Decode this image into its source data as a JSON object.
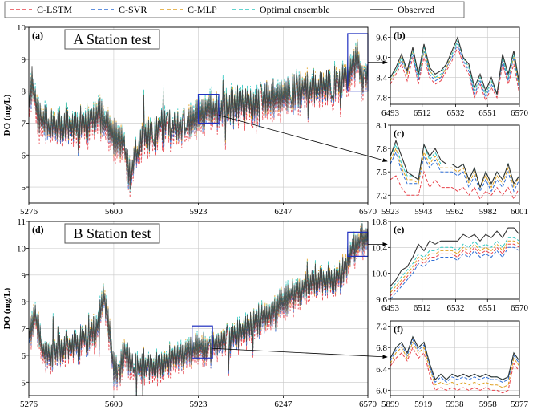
{
  "chart_data": {
    "type": "line",
    "legend": {
      "placement": "top",
      "entries": [
        {
          "label": "C-LSTM",
          "color": "#e8434b",
          "dash": "dashed"
        },
        {
          "label": "C-SVR",
          "color": "#2f6fd6",
          "dash": "dashed"
        },
        {
          "label": "C-MLP",
          "color": "#e0a020",
          "dash": "dashed"
        },
        {
          "label": "Optimal ensemble",
          "color": "#2ec7c0",
          "dash": "dashed"
        },
        {
          "label": "Observed",
          "color": "#444444",
          "dash": "solid"
        }
      ]
    },
    "ylabel": "DO (mg/L)",
    "grid": true,
    "panels": [
      {
        "id": "a",
        "letter": "(a)",
        "title": "A Station test",
        "xlim": [
          5276,
          6570
        ],
        "ylim": [
          4.5,
          10
        ],
        "xticks": [
          5276,
          5600,
          5923,
          6247,
          6570
        ],
        "yticks": [
          5,
          6,
          7,
          8,
          9,
          10
        ],
        "anchors": [
          [
            5276,
            7.8
          ],
          [
            5290,
            8.3
          ],
          [
            5310,
            7.3
          ],
          [
            5350,
            6.9
          ],
          [
            5420,
            6.9
          ],
          [
            5500,
            7.0
          ],
          [
            5540,
            7.3
          ],
          [
            5570,
            7.0
          ],
          [
            5600,
            6.6
          ],
          [
            5640,
            6.3
          ],
          [
            5660,
            5.3
          ],
          [
            5690,
            6.2
          ],
          [
            5720,
            6.6
          ],
          [
            5760,
            6.7
          ],
          [
            5800,
            7.0
          ],
          [
            5850,
            6.8
          ],
          [
            5900,
            7.1
          ],
          [
            5923,
            7.3
          ],
          [
            5960,
            7.5
          ],
          [
            6000,
            7.4
          ],
          [
            6050,
            7.6
          ],
          [
            6100,
            7.7
          ],
          [
            6150,
            7.6
          ],
          [
            6200,
            7.8
          ],
          [
            6247,
            7.9
          ],
          [
            6300,
            8.0
          ],
          [
            6350,
            8.1
          ],
          [
            6400,
            8.1
          ],
          [
            6450,
            8.3
          ],
          [
            6500,
            8.6
          ],
          [
            6530,
            9.1
          ],
          [
            6550,
            8.3
          ],
          [
            6570,
            8.6
          ]
        ],
        "zoom_box": [
          [
            5923,
            7.0
          ],
          [
            6001,
            7.9
          ]
        ]
      },
      {
        "id": "b",
        "letter": "(b)",
        "xlim": [
          6493,
          6570
        ],
        "ylim": [
          7.6,
          9.9
        ],
        "xticks": [
          6493,
          6512,
          6532,
          6551,
          6570
        ],
        "yticks": [
          7.8,
          8.4,
          9.0,
          9.6
        ],
        "observed": [
          8.4,
          8.7,
          9.1,
          8.6,
          9.3,
          8.5,
          9.4,
          8.7,
          8.5,
          8.6,
          8.8,
          9.2,
          9.6,
          9.0,
          8.8,
          8.1,
          8.5,
          8.0,
          8.4,
          7.9,
          9.1,
          8.5,
          9.2,
          8.2
        ],
        "series": [
          {
            "name": "C-LSTM",
            "values": [
              8.2,
              8.5,
              8.8,
              8.3,
              9.0,
              8.2,
              9.0,
              8.4,
              8.2,
              8.3,
              8.6,
              8.9,
              9.3,
              8.8,
              8.5,
              7.8,
              8.2,
              7.7,
              8.1,
              7.8,
              8.8,
              8.2,
              8.8,
              7.9
            ]
          },
          {
            "name": "C-SVR",
            "values": [
              8.3,
              8.6,
              8.9,
              8.5,
              9.1,
              8.3,
              9.2,
              8.5,
              8.3,
              8.4,
              8.7,
              9.0,
              9.4,
              8.9,
              8.6,
              7.9,
              8.3,
              7.8,
              8.2,
              7.9,
              8.9,
              8.3,
              9.0,
              8.0
            ]
          },
          {
            "name": "C-MLP",
            "values": [
              8.3,
              8.6,
              9.0,
              8.5,
              9.2,
              8.4,
              9.2,
              8.6,
              8.4,
              8.4,
              8.7,
              9.1,
              9.5,
              9.0,
              8.7,
              8.0,
              8.4,
              7.9,
              8.3,
              7.9,
              9.0,
              8.4,
              9.0,
              8.1
            ]
          },
          {
            "name": "Optimal ensemble",
            "values": [
              8.4,
              8.6,
              9.0,
              8.6,
              9.2,
              8.4,
              9.3,
              8.6,
              8.4,
              8.5,
              8.8,
              9.1,
              9.5,
              9.0,
              8.7,
              8.0,
              8.4,
              7.9,
              8.3,
              7.9,
              9.0,
              8.4,
              9.1,
              8.1
            ]
          }
        ]
      },
      {
        "id": "c",
        "letter": "(c)",
        "xlim": [
          5923,
          6001
        ],
        "ylim": [
          7.1,
          8.1
        ],
        "xticks": [
          5923,
          5943,
          5962,
          5982,
          6001
        ],
        "yticks": [
          7.2,
          7.5,
          7.8,
          8.1
        ],
        "observed": [
          7.7,
          7.9,
          7.7,
          7.5,
          7.45,
          7.4,
          7.85,
          7.7,
          7.8,
          7.65,
          7.6,
          7.6,
          7.55,
          7.6,
          7.4,
          7.55,
          7.3,
          7.5,
          7.35,
          7.5,
          7.4,
          7.6,
          7.35,
          7.45
        ],
        "series": [
          {
            "name": "C-LSTM",
            "values": [
              7.4,
              7.45,
              7.3,
              7.2,
              7.2,
              7.2,
              7.5,
              7.3,
              7.4,
              7.3,
              7.3,
              7.3,
              7.25,
              7.3,
              7.2,
              7.3,
              7.15,
              7.25,
              7.2,
              7.3,
              7.2,
              7.3,
              7.15,
              7.3
            ]
          },
          {
            "name": "C-SVR",
            "values": [
              7.6,
              7.75,
              7.5,
              7.35,
              7.35,
              7.35,
              7.7,
              7.55,
              7.65,
              7.5,
              7.5,
              7.5,
              7.45,
              7.5,
              7.3,
              7.45,
              7.25,
              7.4,
              7.25,
              7.4,
              7.3,
              7.5,
              7.25,
              7.4
            ]
          },
          {
            "name": "C-MLP",
            "values": [
              7.65,
              7.8,
              7.55,
              7.4,
              7.4,
              7.35,
              7.75,
              7.6,
              7.7,
              7.55,
              7.55,
              7.55,
              7.5,
              7.55,
              7.35,
              7.5,
              7.3,
              7.45,
              7.3,
              7.45,
              7.35,
              7.55,
              7.3,
              7.45
            ]
          },
          {
            "name": "Optimal ensemble",
            "values": [
              7.7,
              7.85,
              7.6,
              7.45,
              7.45,
              7.4,
              7.85,
              7.65,
              7.75,
              7.6,
              7.6,
              7.6,
              7.55,
              7.6,
              7.4,
              7.55,
              7.3,
              7.5,
              7.35,
              7.5,
              7.4,
              7.6,
              7.35,
              7.45
            ]
          }
        ]
      },
      {
        "id": "d",
        "letter": "(d)",
        "title": "B Station test",
        "xlim": [
          5276,
          6570
        ],
        "ylim": [
          4.5,
          11
        ],
        "xticks": [
          5276,
          5600,
          5923,
          6247,
          6570
        ],
        "yticks": [
          5,
          6,
          7,
          8,
          9,
          10,
          11
        ],
        "anchors": [
          [
            5276,
            6.8
          ],
          [
            5300,
            7.6
          ],
          [
            5330,
            6.2
          ],
          [
            5360,
            6.0
          ],
          [
            5400,
            6.3
          ],
          [
            5450,
            6.4
          ],
          [
            5500,
            6.7
          ],
          [
            5540,
            7.1
          ],
          [
            5560,
            8.3
          ],
          [
            5580,
            7.2
          ],
          [
            5600,
            5.6
          ],
          [
            5620,
            5.3
          ],
          [
            5640,
            6.2
          ],
          [
            5660,
            5.8
          ],
          [
            5700,
            5.6
          ],
          [
            5750,
            5.5
          ],
          [
            5800,
            5.8
          ],
          [
            5850,
            6.0
          ],
          [
            5900,
            6.2
          ],
          [
            5923,
            6.4
          ],
          [
            5960,
            6.2
          ],
          [
            6000,
            6.5
          ],
          [
            6050,
            6.7
          ],
          [
            6100,
            7.0
          ],
          [
            6150,
            7.3
          ],
          [
            6200,
            7.6
          ],
          [
            6247,
            8.0
          ],
          [
            6300,
            8.4
          ],
          [
            6350,
            8.7
          ],
          [
            6400,
            8.8
          ],
          [
            6450,
            8.9
          ],
          [
            6480,
            9.2
          ],
          [
            6500,
            9.8
          ],
          [
            6530,
            10.2
          ],
          [
            6570,
            10.5
          ]
        ],
        "zoom_box": [
          [
            5899,
            5.9
          ],
          [
            5977,
            7.1
          ]
        ]
      },
      {
        "id": "e",
        "letter": "(e)",
        "xlim": [
          6493,
          6570
        ],
        "ylim": [
          9.6,
          10.8
        ],
        "xticks": [
          6493,
          6512,
          6532,
          6551,
          6570
        ],
        "yticks": [
          9.6,
          10.0,
          10.4,
          10.8
        ],
        "observed": [
          9.8,
          9.9,
          10.05,
          10.1,
          10.25,
          10.45,
          10.35,
          10.5,
          10.45,
          10.5,
          10.5,
          10.5,
          10.5,
          10.6,
          10.55,
          10.6,
          10.5,
          10.6,
          10.55,
          10.65,
          10.55,
          10.7,
          10.7,
          10.6
        ],
        "series": [
          {
            "name": "C-LSTM",
            "values": [
              9.65,
              9.75,
              9.85,
              9.95,
              10.05,
              10.2,
              10.15,
              10.25,
              10.25,
              10.3,
              10.3,
              10.3,
              10.25,
              10.35,
              10.3,
              10.4,
              10.3,
              10.35,
              10.3,
              10.4,
              10.3,
              10.45,
              10.45,
              10.4
            ]
          },
          {
            "name": "C-SVR",
            "values": [
              9.6,
              9.7,
              9.8,
              9.9,
              10.0,
              10.15,
              10.1,
              10.2,
              10.2,
              10.25,
              10.25,
              10.25,
              10.2,
              10.3,
              10.25,
              10.35,
              10.25,
              10.3,
              10.25,
              10.35,
              10.25,
              10.4,
              10.4,
              10.35
            ]
          },
          {
            "name": "C-MLP",
            "values": [
              9.7,
              9.8,
              9.9,
              10.0,
              10.1,
              10.25,
              10.2,
              10.3,
              10.3,
              10.35,
              10.35,
              10.35,
              10.3,
              10.4,
              10.35,
              10.45,
              10.35,
              10.4,
              10.35,
              10.45,
              10.35,
              10.5,
              10.5,
              10.45
            ]
          },
          {
            "name": "Optimal ensemble",
            "values": [
              9.75,
              9.85,
              9.95,
              10.05,
              10.15,
              10.3,
              10.25,
              10.35,
              10.35,
              10.4,
              10.4,
              10.4,
              10.35,
              10.45,
              10.4,
              10.5,
              10.4,
              10.45,
              10.4,
              10.5,
              10.4,
              10.55,
              10.55,
              10.5
            ]
          }
        ]
      },
      {
        "id": "f",
        "letter": "(f)",
        "xlim": [
          5899,
          5977
        ],
        "ylim": [
          5.9,
          7.3
        ],
        "xticks": [
          5899,
          5919,
          5938,
          5958,
          5977
        ],
        "yticks": [
          6.0,
          6.4,
          6.8,
          7.2
        ],
        "observed": [
          6.6,
          6.8,
          6.9,
          6.7,
          7.0,
          6.8,
          6.9,
          6.5,
          6.2,
          6.3,
          6.2,
          6.3,
          6.25,
          6.3,
          6.25,
          6.3,
          6.25,
          6.3,
          6.25,
          6.25,
          6.2,
          6.25,
          6.7,
          6.55
        ],
        "series": [
          {
            "name": "C-LSTM",
            "values": [
              6.45,
              6.6,
              6.7,
              6.55,
              6.8,
              6.6,
              6.7,
              6.3,
              6.0,
              6.05,
              6.0,
              6.05,
              6.0,
              6.05,
              6.0,
              6.05,
              6.0,
              6.05,
              6.0,
              6.0,
              5.95,
              6.0,
              6.5,
              6.35
            ]
          },
          {
            "name": "C-SVR",
            "values": [
              6.55,
              6.75,
              6.85,
              6.65,
              6.95,
              6.75,
              6.85,
              6.45,
              6.15,
              6.25,
              6.15,
              6.25,
              6.2,
              6.25,
              6.2,
              6.25,
              6.2,
              6.25,
              6.2,
              6.2,
              6.15,
              6.2,
              6.65,
              6.5
            ]
          },
          {
            "name": "C-MLP",
            "values": [
              6.5,
              6.7,
              6.8,
              6.6,
              6.9,
              6.7,
              6.8,
              6.4,
              6.1,
              6.15,
              6.1,
              6.15,
              6.1,
              6.15,
              6.1,
              6.15,
              6.1,
              6.15,
              6.1,
              6.1,
              6.05,
              6.1,
              6.6,
              6.45
            ]
          },
          {
            "name": "Optimal ensemble",
            "values": [
              6.6,
              6.8,
              6.9,
              6.7,
              7.0,
              6.8,
              6.9,
              6.5,
              6.2,
              6.3,
              6.2,
              6.3,
              6.25,
              6.3,
              6.25,
              6.3,
              6.25,
              6.3,
              6.25,
              6.25,
              6.2,
              6.25,
              6.7,
              6.55
            ]
          }
        ]
      }
    ]
  }
}
